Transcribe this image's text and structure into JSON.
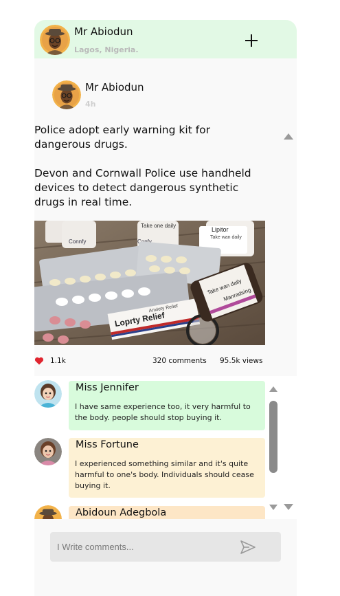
{
  "header": {
    "name": "Mr Abiodun",
    "location": "Lagos, Nigeria."
  },
  "post": {
    "author": "Mr Abiodun",
    "time": "4h",
    "headline": "Police adopt early warning kit for dangerous drugs.",
    "body": "Devon and Cornwall Police use handheld devices to detect dangerous synthetic drugs in real time.",
    "image": {
      "label_lipitor": "Lipitor",
      "label_take_daily": "Take wan daily",
      "label_take_one_daily": "Take one daily",
      "label_confy": "Confy",
      "label_conny": "Connfy",
      "label_relief": "Loprty Relief",
      "label_anxiety": "Anxiety Relief",
      "label_manradsing": "Manradsing",
      "label_take_wan_daily_bottle": "Take wan daily"
    },
    "likes": "1.1k",
    "comments": "320 comments",
    "views": "95.5k views"
  },
  "comments": [
    {
      "name": "Miss Jennifer",
      "text": "I have same experience too, it very harmful to the body. people should stop buying it."
    },
    {
      "name": "Miss Fortune",
      "text": "I experienced something similar and it's quite harmful to one's body. Individuals should cease buying it."
    },
    {
      "name": "Abidoun Adegbola",
      "text": ""
    }
  ],
  "composer": {
    "placeholder": "I Write comments..."
  },
  "colors": {
    "header_bg": "#e2f9e5",
    "comment_green": "#d8fbdc",
    "comment_yellow": "#fdf1d4",
    "heart": "#e0252f"
  }
}
